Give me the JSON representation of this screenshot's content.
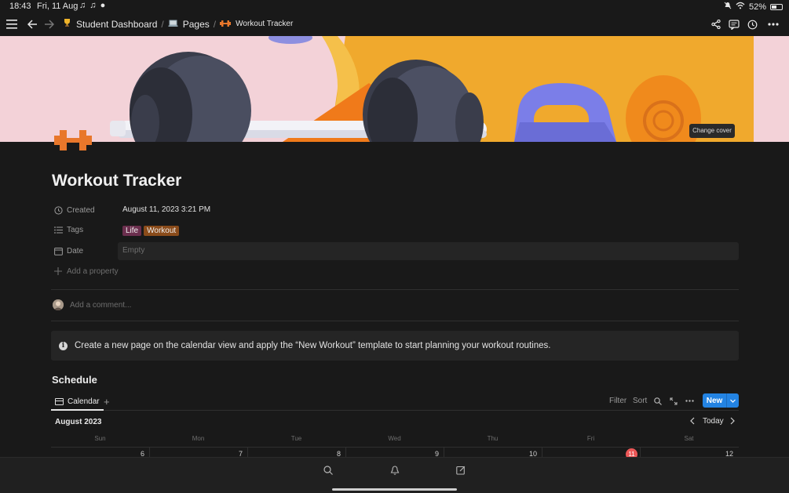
{
  "status": {
    "time": "18:43",
    "date": "Fri, 11 Aug",
    "left_icons": "♫ ♫ ●",
    "battery": "52%",
    "battery_level": 0.52
  },
  "breadcrumb": {
    "items": [
      {
        "emoji": "🏆",
        "label": "Student Dashboard"
      },
      {
        "emoji": "💻",
        "label": "Pages"
      },
      {
        "emoji": "🏋",
        "label": "Workout Tracker"
      }
    ],
    "separator": "/"
  },
  "cover": {
    "change_cover_label": "Change cover"
  },
  "page": {
    "title": "Workout Tracker",
    "properties": {
      "created_label": "Created",
      "created_value": "August 11, 2023 3:21 PM",
      "tags_label": "Tags",
      "tags": [
        {
          "label": "Life",
          "color": "#6b2f4e"
        },
        {
          "label": "Workout",
          "color": "#8a4b1a"
        }
      ],
      "date_label": "Date",
      "date_value": "Empty",
      "add_property_label": "Add a property"
    },
    "comment_placeholder": "Add a comment...",
    "callout": {
      "text": "Create a new page on the calendar view and apply the “New Workout” template to start planning your workout routines."
    }
  },
  "schedule": {
    "heading": "Schedule",
    "tab_label": "Calendar",
    "tools": {
      "filter": "Filter",
      "sort": "Sort",
      "new": "New"
    },
    "month": "August 2023",
    "today_label": "Today",
    "weekdays": [
      "Sun",
      "Mon",
      "Tue",
      "Wed",
      "Thu",
      "Fri",
      "Sat"
    ],
    "days": [
      "6",
      "7",
      "8",
      "9",
      "10",
      "11",
      "12"
    ],
    "today_index": 5
  },
  "colors": {
    "background": "#191919",
    "accent": "#2383e2",
    "today": "#eb5757",
    "cover_bg": "#f3d2d8",
    "icon_orange": "#e8772b"
  }
}
